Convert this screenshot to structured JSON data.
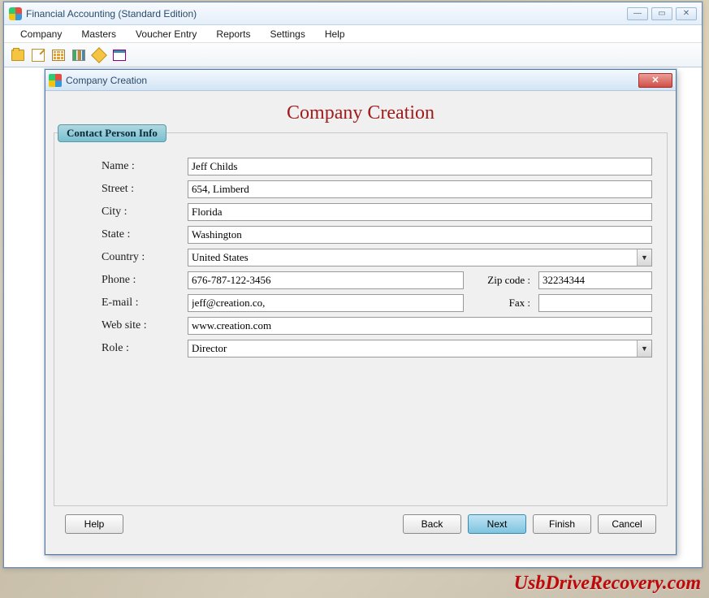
{
  "mainWindow": {
    "title": "Financial Accounting (Standard Edition)"
  },
  "menu": {
    "items": [
      "Company",
      "Masters",
      "Voucher Entry",
      "Reports",
      "Settings",
      "Help"
    ]
  },
  "dialog": {
    "title": "Company Creation",
    "heading": "Company Creation",
    "tabLabel": "Contact Person Info",
    "labels": {
      "name": "Name :",
      "street": "Street :",
      "city": "City :",
      "state": "State :",
      "country": "Country :",
      "phone": "Phone :",
      "zip": "Zip code :",
      "email": "E-mail :",
      "fax": "Fax :",
      "website": "Web site :",
      "role": "Role :"
    },
    "values": {
      "name": "Jeff Childs",
      "street": "654, Limberd",
      "city": "Florida",
      "state": "Washington",
      "country": "United States",
      "phone": "676-787-122-3456",
      "zip": "32234344",
      "email": "jeff@creation.co,",
      "fax": "",
      "website": "www.creation.com",
      "role": "Director"
    },
    "buttons": {
      "help": "Help",
      "back": "Back",
      "next": "Next",
      "finish": "Finish",
      "cancel": "Cancel"
    }
  },
  "watermark": "UsbDriveRecovery.com"
}
